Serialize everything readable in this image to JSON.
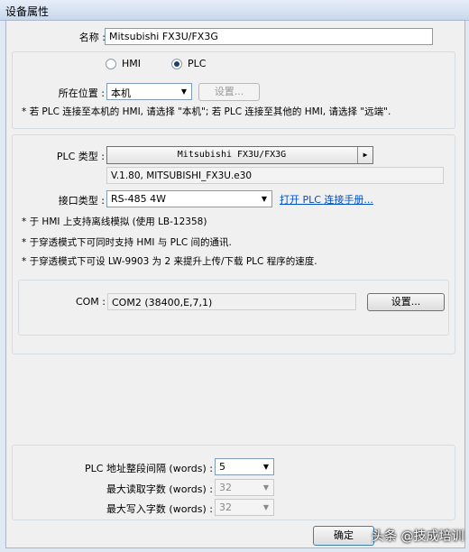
{
  "window": {
    "title": "设备属性"
  },
  "name": {
    "label": "名称 :",
    "value": "Mitsubishi FX3U/FX3G"
  },
  "device_type": {
    "hmi_label": "HMI",
    "plc_label": "PLC",
    "selected": "PLC"
  },
  "location": {
    "label": "所在位置 :",
    "value": "本机",
    "settings_button": "设置...",
    "note": "* 若 PLC 连接至本机的 HMI, 请选择 \"本机\"; 若 PLC 连接至其他的 HMI, 请选择 \"远端\"."
  },
  "plc": {
    "type_label": "PLC 类型 :",
    "type_value": "Mitsubishi FX3U/FX3G",
    "version": "V.1.80, MITSUBISHI_FX3U.e30",
    "interface_label": "接口类型 :",
    "interface_value": "RS-485 4W",
    "manual_link": "打开 PLC 连接手册...",
    "notes": [
      "* 于 HMI 上支持离线模拟 (使用 LB-12358)",
      "* 于穿透模式下可同时支持 HMI 与 PLC 间的通讯.",
      "* 于穿透模式下可设 LW-9903 为 2 来提升上传/下载 PLC 程序的速度."
    ]
  },
  "com": {
    "label": "COM :",
    "value": "COM2 (38400,E,7,1)",
    "settings_button": "设置..."
  },
  "address": {
    "interval_label": "PLC 地址整段间隔 (words) :",
    "interval_value": "5",
    "max_read_label": "最大读取字数 (words) :",
    "max_read_value": "32",
    "max_write_label": "最大写入字数 (words) :",
    "max_write_value": "32"
  },
  "footer": {
    "ok_button": "确定"
  },
  "watermark": "头条 @技成培训",
  "icons": {
    "dropdown": "chevron-down-icon",
    "submenu": "triangle-right-icon"
  }
}
